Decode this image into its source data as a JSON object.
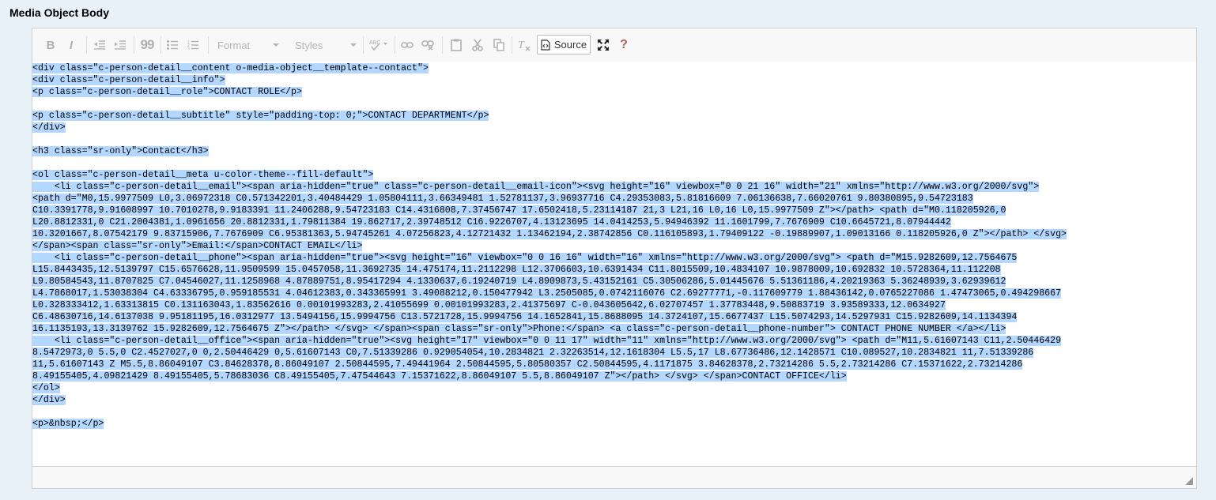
{
  "field": {
    "label": "Media Object Body"
  },
  "toolbar": {
    "bold": "B",
    "italic": "I",
    "blockquote": "99",
    "format_label": "Format",
    "styles_label": "Styles",
    "spell_label": "ABC",
    "source_label": "Source",
    "help": "?"
  },
  "source_lines": [
    "<div class=\"c-person-detail__content o-media-object__template--contact\">",
    "<div class=\"c-person-detail__info\">",
    "<p class=\"c-person-detail__role\">CONTACT ROLE</p>",
    "",
    "<p class=\"c-person-detail__subtitle\" style=\"padding-top: 0;\">CONTACT DEPARTMENT</p>",
    "</div>",
    "",
    "<h3 class=\"sr-only\">Contact</h3>",
    "",
    "<ol class=\"c-person-detail__meta u-color-theme--fill-default\">",
    "    <li class=\"c-person-detail__email\"><span aria-hidden=\"true\" class=\"c-person-detail__email-icon\"><svg height=\"16\" viewbox=\"0 0 21 16\" width=\"21\" xmlns=\"http://www.w3.org/2000/svg\">",
    "<path d=\"M0,15.9977509 L0,3.06972318 C0.571342201,3.40484429 1.05804111,3.66349481 1.52781137,3.96937716 C4.29353083,5.81816609 7.06136638,7.66020761 9.80380895,9.54723183",
    "C10.3391778,9.91608997 10.7010278,9.9183391 11.2406288,9.54723183 C14.4316808,7.37456747 17.6502418,5.23114187 21,3 L21,16 L0,16 L0,15.9977509 Z\"></path> <path d=\"M0.118205926,0",
    "L20.8812331,0 C21.2004381,1.0961656 20.8812331,1.79811384 19.862717,2.39748512 C16.9226707,4.13123695 14.0414253,5.94946392 11.1601799,7.7676909 C10.6645721,8.07944442",
    "10.3201667,8.07542179 9.83715906,7.7676909 C6.95381363,5.94745261 4.07256823,4.12721432 1.13462194,2.38742856 C0.116105893,1.79409122 -0.19889907,1.09013166 0.118205926,0 Z\"></path> </svg>",
    "</span><span class=\"sr-only\">Email:</span>CONTACT EMAIL</li>",
    "    <li class=\"c-person-detail__phone\"><span aria-hidden=\"true\"><svg height=\"16\" viewbox=\"0 0 16 16\" width=\"16\" xmlns=\"http://www.w3.org/2000/svg\"> <path d=\"M15.9282609,12.7564675",
    "L15.8443435,12.5139797 C15.6576628,11.9509599 15.0457058,11.3692735 14.475174,11.2112298 L12.3706603,10.6391434 C11.8015509,10.4834107 10.9878009,10.692832 10.5728364,11.112208",
    "L9.80584543,11.8707825 C7.04546027,11.1258968 4.87889751,8.95417294 4.1330637,6.19240719 L4.8909873,5.43152161 C5.30506286,5.01445676 5.51361186,4.20219363 5.36248939,3.62939612",
    "L4.7868017,1.53038304 C4.63336795,0.959185531 4.04612383,0.343365991 3.49088212,0.150477942 L3.2505085,0.0742116076 C2.69277771,-0.117609779 1.88436142,0.0765227086 1.47473065,0.494298667",
    "L0.328333412,1.63313815 C0.131163043,1.83562616 0.00101993283,2.41055699 0.00101993283,2.41375697 C-0.043605642,6.02707457 1.37783448,9.50883719 3.93589333,12.0634927",
    "C6.48630716,14.6137038 9.95181195,16.0312977 13.5494156,15.9994756 C13.5721728,15.9994756 14.1652841,15.8688095 14.3724107,15.6677437 L15.5074293,14.5297931 C15.9282609,14.1134394",
    "16.1135193,13.3139762 15.9282609,12.7564675 Z\"></path> </svg> </span><span class=\"sr-only\">Phone:</span> <a class=\"c-person-detail__phone-number\"> CONTACT PHONE NUMBER </a></li>",
    "    <li class=\"c-person-detail__office\"><span aria-hidden=\"true\"><svg height=\"17\" viewbox=\"0 0 11 17\" width=\"11\" xmlns=\"http://www.w3.org/2000/svg\"> <path d=\"M11,5.61607143 C11,2.50446429",
    "8.5472973,0 5.5,0 C2.4527027,0 0,2.50446429 0,5.61607143 C0,7.51339286 0.929054054,10.2834821 2.32263514,12.1618304 L5.5,17 L8.67736486,12.1428571 C10.089527,10.2834821 11,7.51339286",
    "11,5.61607143 Z M5.5,8.86049107 C3.84628378,8.86049107 2.50844595,7.49441964 2.50844595,5.80580357 C2.50844595,4.1171875 3.84628378,2.73214286 5.5,2.73214286 C7.15371622,2.73214286",
    "8.49155405,4.09821429 8.49155405,5.78683036 C8.49155405,7.47544643 7.15371622,8.86049107 5.5,8.86049107 Z\"></path> </svg> </span>CONTACT OFFICE</li>",
    "</ol>",
    "</div>",
    "",
    "<p>&nbsp;</p>"
  ]
}
